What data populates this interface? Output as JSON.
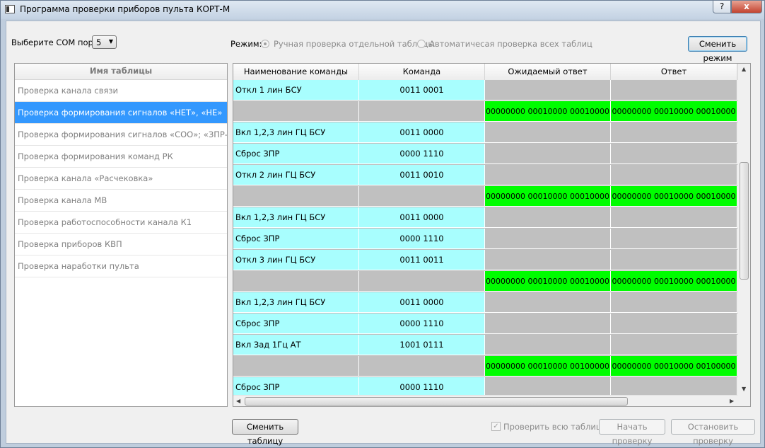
{
  "window": {
    "title": "Программа проверки приборов пульта КОРТ-М",
    "help_label": "?",
    "close_label": "x"
  },
  "toolbar": {
    "com_label": "Выберите COM порт:",
    "com_value": "5",
    "mode_label": "Режим:",
    "mode_manual": "Ручная проверка отдельной таблицы",
    "mode_auto": "Автоматичесая проверка всех таблиц",
    "change_mode": "Сменить режим"
  },
  "tables_list": {
    "header": "Имя таблицы",
    "items": [
      "Проверка канала связи",
      "Проверка формирования сигналов «НЕТ», «НЕ»",
      "Проверка формирования сигналов «СОО»; «ЗПР-...",
      "Проверка формирования команд РК",
      "Проверка канала «Расчековка»",
      "Проверка канала МВ",
      "Проверка работоспособности канала К1",
      "Проверка приборов КВП",
      "Проверка наработки пульта"
    ],
    "selected_index": 1
  },
  "grid": {
    "columns": [
      "Наименование команды",
      "Команда",
      "Ожидаемый ответ",
      "Ответ"
    ],
    "rows": [
      {
        "type": "cmd",
        "name": "Откл 1 лин БСУ",
        "code": "0011 0001"
      },
      {
        "type": "resp",
        "expected": "00000000  00010000  00010000",
        "answer": "00000000  00010000  00010000"
      },
      {
        "type": "cmd",
        "name": "Вкл 1,2,3 лин ГЦ БСУ",
        "code": "0011 0000"
      },
      {
        "type": "cmd",
        "name": "Сброс ЗПР",
        "code": "0000 1110"
      },
      {
        "type": "cmd",
        "name": "Откл 2 лин ГЦ БСУ",
        "code": "0011 0010"
      },
      {
        "type": "resp",
        "expected": "00000000  00010000  00010000",
        "answer": "00000000  00010000  00010000"
      },
      {
        "type": "cmd",
        "name": "Вкл 1,2,3 лин ГЦ БСУ",
        "code": "0011 0000"
      },
      {
        "type": "cmd",
        "name": "Сброс ЗПР",
        "code": "0000 1110"
      },
      {
        "type": "cmd",
        "name": "Откл 3 лин ГЦ БСУ",
        "code": "0011 0011"
      },
      {
        "type": "resp",
        "expected": "00000000  00010000  00010000",
        "answer": "00000000  00010000  00010000"
      },
      {
        "type": "cmd",
        "name": "Вкл 1,2,3 лин ГЦ БСУ",
        "code": "0011 0000"
      },
      {
        "type": "cmd",
        "name": "Сброс ЗПР",
        "code": "0000 1110"
      },
      {
        "type": "cmd",
        "name": "Вкл Зад 1Гц АТ",
        "code": "1001 0111"
      },
      {
        "type": "resp",
        "expected": "00000000  00010000  00100000",
        "answer": "00000000  00010000  00100000"
      },
      {
        "type": "cmd",
        "name": "Сброс ЗПР",
        "code": "0000 1110"
      }
    ],
    "colors": {
      "command": "#a8fefe",
      "empty": "#c0c0c0",
      "response": "#00fd00"
    }
  },
  "footer": {
    "change_table": "Сменить таблицу",
    "check_all": "Проверить всю таблицу",
    "check_all_checked": true,
    "start": "Начать проверку",
    "stop": "Остановить проверку"
  }
}
